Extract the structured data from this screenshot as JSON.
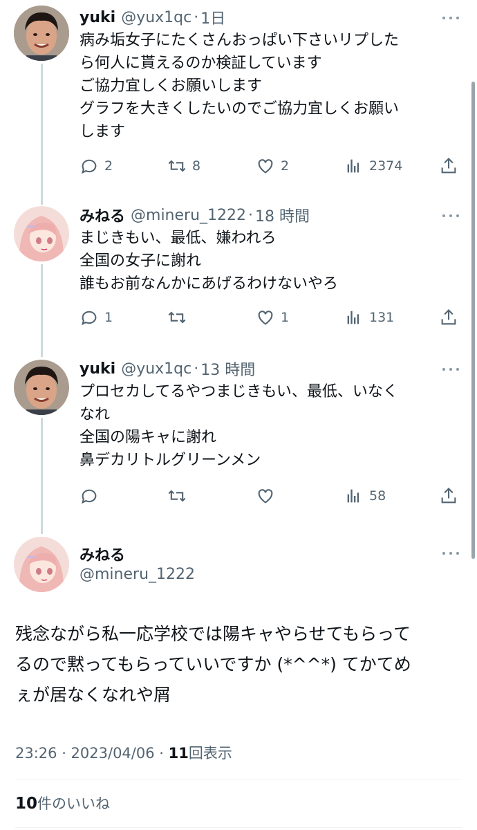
{
  "colors": {
    "text": "#0f1419",
    "muted": "#536471",
    "line": "#cfd9de"
  },
  "thread": [
    {
      "name": "yuki",
      "handle": "@yux1qc",
      "time": "1日",
      "avatar": "person-photo",
      "lines": [
        "病み垢女子にたくさんおっぱい下さいリプした",
        "ら何人に貰えるのか検証しています",
        "ご協力宜しくお願いします",
        "グラフを大きくしたいのでご協力宜しくお願い",
        "します"
      ],
      "replies": "2",
      "retweets": "8",
      "likes": "2",
      "views": "2374"
    },
    {
      "name": "みねる",
      "handle": "@mineru_1222",
      "time": "18 時間",
      "avatar": "anime-girl",
      "lines": [
        "まじきもい、最低、嫌われろ",
        "全国の女子に謝れ",
        "誰もお前なんかにあげるわけないやろ"
      ],
      "replies": "1",
      "retweets": "",
      "likes": "1",
      "views": "131"
    },
    {
      "name": "yuki",
      "handle": "@yux1qc",
      "time": "13 時間",
      "avatar": "person-photo",
      "lines": [
        "プロセカしてるやつまじきもい、最低、いなく",
        "なれ",
        "全国の陽キャに謝れ",
        "鼻デカリトルグリーンメン"
      ],
      "replies": "",
      "retweets": "",
      "likes": "",
      "views": "58"
    }
  ],
  "main": {
    "name": "みねる",
    "handle": "@mineru_1222",
    "lines": [
      "残念ながら私一応学校では陽キャやらせてもらって",
      "るので黙ってもらっていいですか (*^^*) てかてめ",
      "ぇが居なくなれや屑"
    ],
    "time": "23:26 · 2023/04/06 · ",
    "views_count": "11",
    "views_label": "回表示",
    "likes_count": "10",
    "likes_label": "件のいいね"
  }
}
